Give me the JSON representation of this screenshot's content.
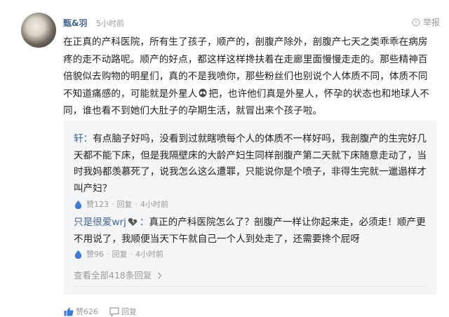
{
  "comment": {
    "author": "甄&羽",
    "time": "5小时前",
    "report_label": "举报",
    "text_before_icon": "在正真的产科医院，所有生了孩子，顺产的，剖腹产除外，剖腹产七天之类乖乖在病房疼的走不动路呢。顺产的好点，都这样这样搀扶着在走廊里面慢慢走走的。那些精神百倍貌似去购物的明星们，真的不是我喷你，那些粉丝们也别说个人体质不同，体质不同不知道痛感的，可能就是外星人",
    "text_after_icon": "把，也许他们真是外星人，怀孕的状态也和地球人不同，谁也看不到她们大肚子的孕期生活，就冒出来个孩子啦。",
    "likes": "赞626",
    "reply_label": "回复"
  },
  "replies": [
    {
      "name": "轩",
      "separator": "：",
      "text": "有点脑子好吗，没看到过就瞎喷每个人的体质不一样好吗，我剖腹产的生完好几天都不能下床，但是我隔壁床的大龄产妇生同样剖腹产第二天就下床随意走动了，当时我妈都羡慕死了，说我怎么这么遭罪，只能说你是个喷子，非得生完就一邋遢样才叫产妇？",
      "likes": "赞123",
      "reply_label": "回复",
      "time": "4小时前"
    },
    {
      "name": "只是很爱wrj",
      "separator": "：",
      "text": "真正的产科医院怎么了？剖腹产一样让你起来走，必须走！顺产更不用说了，我顺便当天下午就自己一个人到处走了，还需要搀个屁呀",
      "likes": "赞96",
      "reply_label": "回复",
      "time": "4小时前"
    }
  ],
  "view_all_label": "查看全部418条回复",
  "colors": {
    "name_blue": "#406599",
    "meta_gray": "#999999",
    "reply_bg": "#f4f5f6",
    "like_icon_blue": "#3d7bd6"
  },
  "icons": [
    "report-icon",
    "alien-emoji-icon",
    "like-icon",
    "broken-heart-icon",
    "thumbs-up-icon",
    "reply-icon"
  ]
}
